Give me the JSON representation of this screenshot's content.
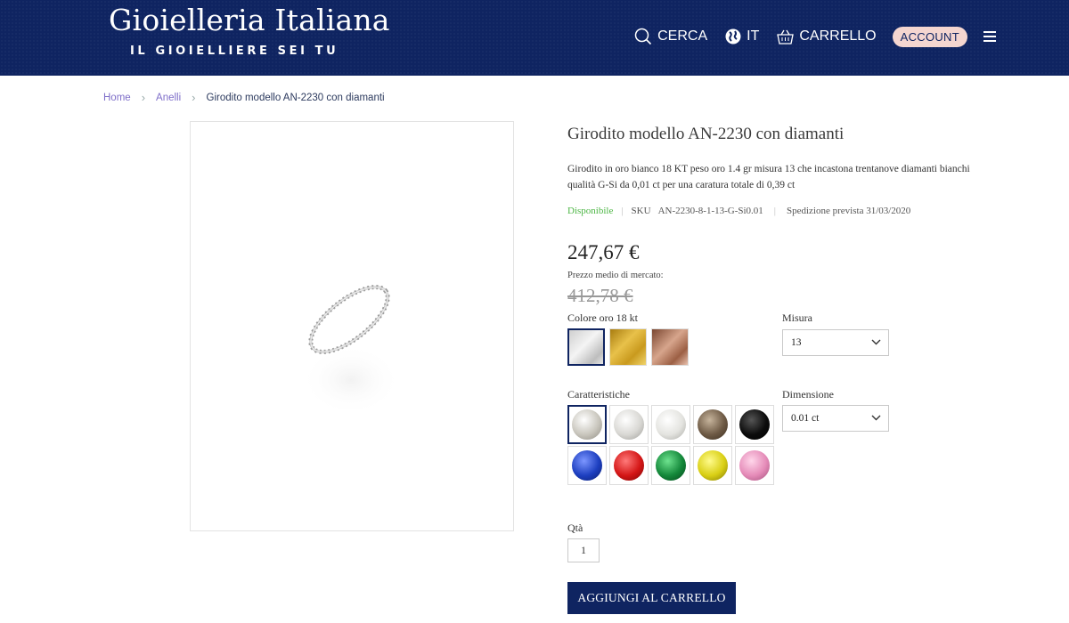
{
  "header": {
    "brand_name": "Gioielleria Italiana",
    "brand_tagline": "IL GIOIELLIERE SEI TU",
    "search_label": "CERCA",
    "language_label": "IT",
    "cart_label": "CARRELLO",
    "account_label": "ACCOUNT",
    "bg_color": "#0f2461"
  },
  "breadcrumb": {
    "items": [
      "Home",
      "Anelli"
    ],
    "current": "Girodito modello AN-2230 con diamanti"
  },
  "product": {
    "title": "Girodito modello AN-2230 con diamanti",
    "description": "Girodito in oro bianco 18 KT peso oro 1.4 gr misura 13 che incastona trentanove diamanti bianchi qualità G-Si da 0,01 ct per una caratura totale di 0,39 ct",
    "availability": "Disponibile",
    "sku_label": "SKU",
    "sku": "AN-2230-8-1-13-G-Si0.01",
    "shipping": "Spedizione prevista 31/03/2020",
    "price": "247,67 €",
    "market_price_label": "Prezzo medio di mercato:",
    "market_price": "412,78 €"
  },
  "options": {
    "gold_color_label": "Colore oro 18 kt",
    "gold_colors": [
      "white-gold",
      "yellow-gold",
      "rose-gold"
    ],
    "size_label": "Misura",
    "size_value": "13",
    "features_label": "Caratteristiche",
    "dimension_label": "Dimensione",
    "dimension_value": "0.01 ct",
    "gems": [
      {
        "name": "white-diamond-1",
        "color": "#c9c6bd"
      },
      {
        "name": "white-diamond-2",
        "color": "#d9d8d4"
      },
      {
        "name": "white-diamond-3",
        "color": "#e4e4e0"
      },
      {
        "name": "brown-diamond",
        "color": "#6e5a45"
      },
      {
        "name": "black-diamond",
        "color": "#0c0c0c"
      },
      {
        "name": "sapphire",
        "color": "#1d3fc0"
      },
      {
        "name": "ruby",
        "color": "#d41616"
      },
      {
        "name": "emerald",
        "color": "#14883a"
      },
      {
        "name": "yellow-sapphire",
        "color": "#d9cf14"
      },
      {
        "name": "pink-sapphire",
        "color": "#e58bb8"
      }
    ],
    "qty_label": "Qtà",
    "qty_value": "1",
    "add_to_cart_label": "AGGIUNGI AL CARRELLO"
  }
}
